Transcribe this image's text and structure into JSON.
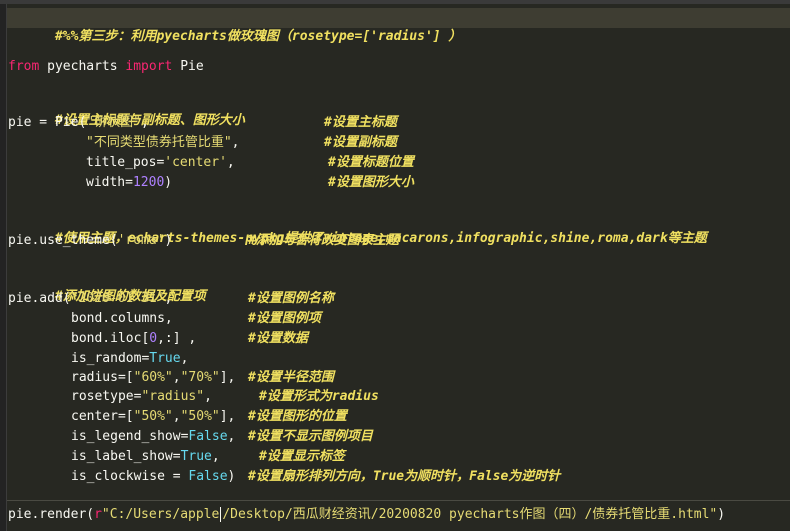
{
  "lines": {
    "step": "#%%第三步：利用pyecharts做玫瑰图（rosetype=['radius'] ）",
    "import_from": "from",
    "import_mod": " pyecharts ",
    "import_kw": "import",
    "import_name": " Pie",
    "c_title": "#设置主标题与副标题、图形大小",
    "pie_head": "pie = Pie(",
    "pie_title": "\"饼状图\"",
    "pie_title_comma": ",",
    "pie_title_cmt": "#设置主标题",
    "pie_sub": "\"不同类型债券托管比重\"",
    "pie_sub_comma": ",",
    "pie_sub_cmt": "#设置副标题",
    "pos_key": "title_pos=",
    "pos_val": "'center'",
    "pos_comma": ",",
    "pos_cmt": "#设置标题位置",
    "width_key": "width=",
    "width_val": "1200",
    "width_close": ")",
    "width_cmt": "#设置图形大小",
    "c_theme": "#使用主题，echarts-themes-pypkg提供了vintage,macarons,infographic,shine,roma,dark等主题",
    "theme_head": "pie.use_theme(",
    "theme_val": "'roma'",
    "theme_close": ")",
    "theme_cmt": "#添加与否将改变图表主题",
    "c_add": "#添加饼图的数据及配置项",
    "add_head": "pie.add(",
    "add_date": "\"2020-01-31\"",
    "add_comma": ",",
    "add_cmt": "#设置图例名称",
    "cols": "bond.columns,",
    "cols_cmt": "#设置图例项",
    "iloc_a": "bond.iloc[",
    "iloc_n": "0",
    "iloc_b": ",:] ,",
    "iloc_cmt": "#设置数据",
    "rand_key": "is_random=",
    "rand_val": "True",
    "rand_comma": ",",
    "radius_key": "radius=[",
    "radius_a": "\"60%\"",
    "radius_sep": ",",
    "radius_b": "\"70%\"",
    "radius_close": "],",
    "radius_cmt": "#设置半径范围",
    "rose_key": "rosetype=",
    "rose_val": "\"radius\"",
    "rose_comma": ",",
    "rose_cmt": "#设置形式为radius",
    "center_key": "center=[",
    "center_a": "\"50%\"",
    "center_sep": ",",
    "center_b": "\"50%\"",
    "center_close": "],",
    "center_cmt": "#设置图形的位置",
    "legend_key": "is_legend_show=",
    "legend_val": "False",
    "legend_comma": ",",
    "legend_cmt": "#设置不显示图例项目",
    "label_key": "is_label_show=",
    "label_val": "True",
    "label_comma": ",",
    "label_cmt": "#设置显示标签",
    "clock_key": "is_clockwise = ",
    "clock_val": "False",
    "clock_close": ")",
    "clock_cmt": "#设置扇形排列方向，True为顺时针，False为逆时针",
    "render_head": "pie.render(",
    "render_prefix": "r",
    "render_path_a": "\"C:/Users/apple",
    "render_path_b": "/Desktop/西瓜财经资讯/20200820 pyecharts作图（四）/债券托管比重.html\"",
    "render_close": ")"
  }
}
